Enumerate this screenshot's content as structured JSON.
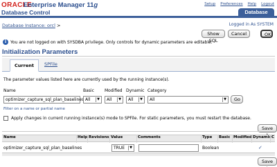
{
  "header": {
    "oracle_logo": "ORACLE",
    "product": "Enterprise Manager 11",
    "product_version": "g",
    "subtitle": "Database Control",
    "links": [
      "Setup",
      "Preferences",
      "Help",
      "Logout"
    ],
    "tab_label": "Database"
  },
  "instance_label": "Database Instance: orcl",
  "instance_suffix": ">",
  "logged_in": "Logged in As SYSTEM",
  "buttons": {
    "show_sql": "Show SQL",
    "cancel": "Cancel",
    "ok": "OK",
    "go": "Go",
    "save_top": "Save t",
    "save_bottom": "Save t"
  },
  "warning": "You are not logged on with SYSDBA privilege. Only controls for dynamic parameters are editable.",
  "section_title": "Initialization Parameters",
  "tabs": [
    "Current",
    "SPFile"
  ],
  "intro": "The parameter values listed here are currently used by the running instance(s).",
  "filter": {
    "name_label": "Name",
    "name_value": "optimizer_capture_sql_plan_baselines",
    "basic_label": "Basic",
    "basic_value": "All",
    "modified_label": "Modified",
    "modified_value": "All",
    "dynamic_label": "Dynamic",
    "dynamic_value": "All",
    "category_label": "Category",
    "category_value": "All",
    "hint": "Filter on a name or partial name"
  },
  "apply_text": "Apply changes in current running instance(s) mode to SPFile. For static parameters, you must restart the database.",
  "table": {
    "columns": [
      "Name",
      "Help",
      "Revisions",
      "Value",
      "Comments",
      "Type",
      "Basic",
      "Modified",
      "Dynamic",
      "C"
    ],
    "rows": [
      {
        "name": "optimizer_capture_sql_plan_baselines",
        "value": "TRUE",
        "comments": "",
        "type": "Boolean",
        "dynamic": "✓"
      }
    ]
  },
  "colors": {
    "brand_red": "#d2231c",
    "link_blue": "#2c4f8e",
    "tab_bar_blue": "#3c5f9a"
  }
}
